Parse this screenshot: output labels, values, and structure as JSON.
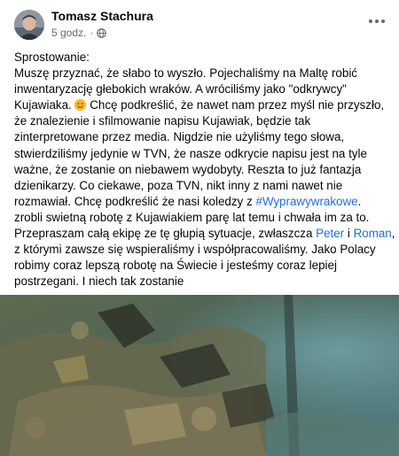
{
  "post": {
    "author": "Tomasz Stachura",
    "time": "5 godz.",
    "separator": "·",
    "audience_icon": "globe-icon",
    "more_icon": "more-horizontal-icon",
    "body_lines": [
      {
        "segments": [
          {
            "text": "Sprostowanie:"
          }
        ]
      },
      {
        "segments": [
          {
            "text": "Muszę przyznać, że słabo to wyszło. Pojechaliśmy na Maltę robić"
          }
        ]
      },
      {
        "segments": [
          {
            "text": "inwentaryzację głebokich wraków. A wróciliśmy jako \"odkrywcy\""
          }
        ]
      },
      {
        "segments": [
          {
            "text": "Kujawiaka. "
          },
          {
            "emoji": "smiling-face-emoji"
          },
          {
            "text": " Chcę podkreślić, że nawet nam przez myśl nie przyszło,"
          }
        ]
      },
      {
        "segments": [
          {
            "text": "że znalezienie i sfilmowanie napisu Kujawiak, będzie tak"
          }
        ]
      },
      {
        "segments": [
          {
            "text": "zinterpretowane przez media. Nigdzie nie użyliśmy tego słowa,"
          }
        ]
      },
      {
        "segments": [
          {
            "text": "stwierdziliśmy jedynie w TVN, że nasze odkrycie napisu jest na tyle"
          }
        ]
      },
      {
        "segments": [
          {
            "text": "ważne, że zostanie on niebawem wydobyty. Reszta to już fantazja"
          }
        ]
      },
      {
        "segments": [
          {
            "text": "dzienikarzy. Co ciekawe, poza TVN, nikt inny z nami nawet nie"
          }
        ]
      },
      {
        "segments": [
          {
            "text": "rozmawiał. Chcę podkreślić że nasi koledzy z "
          },
          {
            "link": "#Wyprawywrakowe"
          },
          {
            "text": "."
          }
        ]
      },
      {
        "segments": [
          {
            "text": "zrobli swietną robotę z Kujawiakiem parę lat temu i chwała im za to."
          }
        ]
      },
      {
        "segments": [
          {
            "text": "Przepraszam całą ekipę ze tę głupią sytuacje, zwłaszcza "
          },
          {
            "link": "Peter"
          },
          {
            "text": " i "
          },
          {
            "link": "Roman"
          },
          {
            "text": ","
          }
        ]
      },
      {
        "segments": [
          {
            "text": "z którymi zawsze się wspieraliśmy i współpracowaliśmy. Jako Polacy"
          }
        ]
      },
      {
        "segments": [
          {
            "text": "robimy coraz lepszą robotę na Świecie i jesteśmy coraz lepiej"
          }
        ]
      },
      {
        "segments": [
          {
            "text": "postrzegani. I niech tak zostanie"
          }
        ]
      }
    ]
  },
  "colors": {
    "link": "#216fdb",
    "meta": "#65676b",
    "text": "#050505"
  }
}
